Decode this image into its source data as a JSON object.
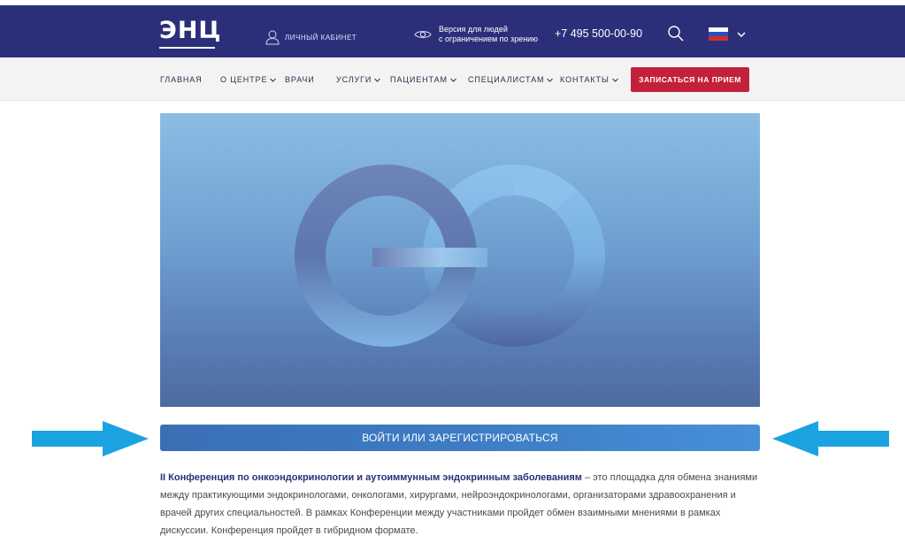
{
  "header": {
    "logo_text": "ЭНЦ",
    "cabinet_label": "ЛИЧНЫЙ КАБИНЕТ",
    "vision_line1": "Версия для людей",
    "vision_line2": "с ограничением по зрению",
    "phone": "+7 495 500-00-90",
    "language": "ru",
    "colors": {
      "header_bg": "#2b2f7a",
      "cta_bg": "#c3213b",
      "login_bar": "#3d7cc4",
      "arrow": "#1aa3e0"
    }
  },
  "nav": {
    "items": [
      {
        "label": "ГЛАВНАЯ",
        "dropdown": false
      },
      {
        "label": "О ЦЕНТРЕ",
        "dropdown": true
      },
      {
        "label": "ВРАЧИ",
        "dropdown": false
      },
      {
        "label": "УСЛУГИ",
        "dropdown": true
      },
      {
        "label": "ПАЦИЕНТАМ",
        "dropdown": true
      },
      {
        "label": "СПЕЦИАЛИСТАМ",
        "dropdown": true
      },
      {
        "label": "КОНТАКТЫ",
        "dropdown": true
      }
    ],
    "cta_label": "ЗАПИСАТЬСЯ НА ПРИЕМ"
  },
  "main": {
    "login_label": "ВОЙТИ ИЛИ ЗАРЕГИСТРИРОВАТЬСЯ",
    "desc_bold": "II Конференция по онкоэндокринологии и аутоиммунным эндокринным заболеваниям",
    "desc_rest": " – это площадка для обмена знаниями между практикующими эндокринологами, онкологами, хирургами, нейроэндокринологами, организаторами здравоохранения и врачей других специальностей. В рамках Конференции между участниками пройдет обмен взаимными мнениями в рамках дискуссии. Конференция пройдет в гибридном формате."
  }
}
